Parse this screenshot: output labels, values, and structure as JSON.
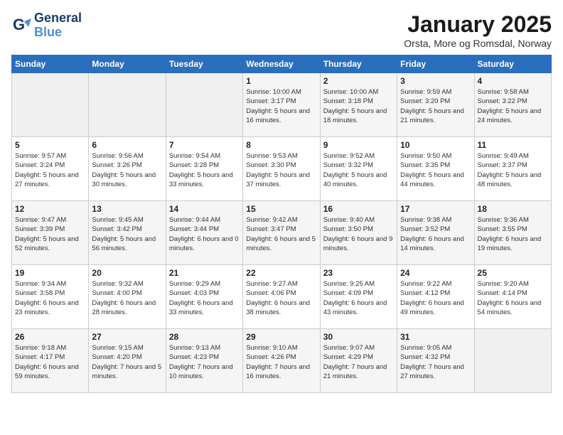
{
  "header": {
    "logo_line1": "General",
    "logo_line2": "Blue",
    "month": "January 2025",
    "location": "Orsta, More og Romsdal, Norway"
  },
  "weekdays": [
    "Sunday",
    "Monday",
    "Tuesday",
    "Wednesday",
    "Thursday",
    "Friday",
    "Saturday"
  ],
  "weeks": [
    [
      {
        "day": "",
        "info": ""
      },
      {
        "day": "",
        "info": ""
      },
      {
        "day": "",
        "info": ""
      },
      {
        "day": "1",
        "info": "Sunrise: 10:00 AM\nSunset: 3:17 PM\nDaylight: 5 hours\nand 16 minutes."
      },
      {
        "day": "2",
        "info": "Sunrise: 10:00 AM\nSunset: 3:18 PM\nDaylight: 5 hours\nand 18 minutes."
      },
      {
        "day": "3",
        "info": "Sunrise: 9:59 AM\nSunset: 3:20 PM\nDaylight: 5 hours\nand 21 minutes."
      },
      {
        "day": "4",
        "info": "Sunrise: 9:58 AM\nSunset: 3:22 PM\nDaylight: 5 hours\nand 24 minutes."
      }
    ],
    [
      {
        "day": "5",
        "info": "Sunrise: 9:57 AM\nSunset: 3:24 PM\nDaylight: 5 hours\nand 27 minutes."
      },
      {
        "day": "6",
        "info": "Sunrise: 9:56 AM\nSunset: 3:26 PM\nDaylight: 5 hours\nand 30 minutes."
      },
      {
        "day": "7",
        "info": "Sunrise: 9:54 AM\nSunset: 3:28 PM\nDaylight: 5 hours\nand 33 minutes."
      },
      {
        "day": "8",
        "info": "Sunrise: 9:53 AM\nSunset: 3:30 PM\nDaylight: 5 hours\nand 37 minutes."
      },
      {
        "day": "9",
        "info": "Sunrise: 9:52 AM\nSunset: 3:32 PM\nDaylight: 5 hours\nand 40 minutes."
      },
      {
        "day": "10",
        "info": "Sunrise: 9:50 AM\nSunset: 3:35 PM\nDaylight: 5 hours\nand 44 minutes."
      },
      {
        "day": "11",
        "info": "Sunrise: 9:49 AM\nSunset: 3:37 PM\nDaylight: 5 hours\nand 48 minutes."
      }
    ],
    [
      {
        "day": "12",
        "info": "Sunrise: 9:47 AM\nSunset: 3:39 PM\nDaylight: 5 hours\nand 52 minutes."
      },
      {
        "day": "13",
        "info": "Sunrise: 9:45 AM\nSunset: 3:42 PM\nDaylight: 5 hours\nand 56 minutes."
      },
      {
        "day": "14",
        "info": "Sunrise: 9:44 AM\nSunset: 3:44 PM\nDaylight: 6 hours\nand 0 minutes."
      },
      {
        "day": "15",
        "info": "Sunrise: 9:42 AM\nSunset: 3:47 PM\nDaylight: 6 hours\nand 5 minutes."
      },
      {
        "day": "16",
        "info": "Sunrise: 9:40 AM\nSunset: 3:50 PM\nDaylight: 6 hours\nand 9 minutes."
      },
      {
        "day": "17",
        "info": "Sunrise: 9:38 AM\nSunset: 3:52 PM\nDaylight: 6 hours\nand 14 minutes."
      },
      {
        "day": "18",
        "info": "Sunrise: 9:36 AM\nSunset: 3:55 PM\nDaylight: 6 hours\nand 19 minutes."
      }
    ],
    [
      {
        "day": "19",
        "info": "Sunrise: 9:34 AM\nSunset: 3:58 PM\nDaylight: 6 hours\nand 23 minutes."
      },
      {
        "day": "20",
        "info": "Sunrise: 9:32 AM\nSunset: 4:00 PM\nDaylight: 6 hours\nand 28 minutes."
      },
      {
        "day": "21",
        "info": "Sunrise: 9:29 AM\nSunset: 4:03 PM\nDaylight: 6 hours\nand 33 minutes."
      },
      {
        "day": "22",
        "info": "Sunrise: 9:27 AM\nSunset: 4:06 PM\nDaylight: 6 hours\nand 38 minutes."
      },
      {
        "day": "23",
        "info": "Sunrise: 9:25 AM\nSunset: 4:09 PM\nDaylight: 6 hours\nand 43 minutes."
      },
      {
        "day": "24",
        "info": "Sunrise: 9:22 AM\nSunset: 4:12 PM\nDaylight: 6 hours\nand 49 minutes."
      },
      {
        "day": "25",
        "info": "Sunrise: 9:20 AM\nSunset: 4:14 PM\nDaylight: 6 hours\nand 54 minutes."
      }
    ],
    [
      {
        "day": "26",
        "info": "Sunrise: 9:18 AM\nSunset: 4:17 PM\nDaylight: 6 hours\nand 59 minutes."
      },
      {
        "day": "27",
        "info": "Sunrise: 9:15 AM\nSunset: 4:20 PM\nDaylight: 7 hours\nand 5 minutes."
      },
      {
        "day": "28",
        "info": "Sunrise: 9:13 AM\nSunset: 4:23 PM\nDaylight: 7 hours\nand 10 minutes."
      },
      {
        "day": "29",
        "info": "Sunrise: 9:10 AM\nSunset: 4:26 PM\nDaylight: 7 hours\nand 16 minutes."
      },
      {
        "day": "30",
        "info": "Sunrise: 9:07 AM\nSunset: 4:29 PM\nDaylight: 7 hours\nand 21 minutes."
      },
      {
        "day": "31",
        "info": "Sunrise: 9:05 AM\nSunset: 4:32 PM\nDaylight: 7 hours\nand 27 minutes."
      },
      {
        "day": "",
        "info": ""
      }
    ]
  ]
}
